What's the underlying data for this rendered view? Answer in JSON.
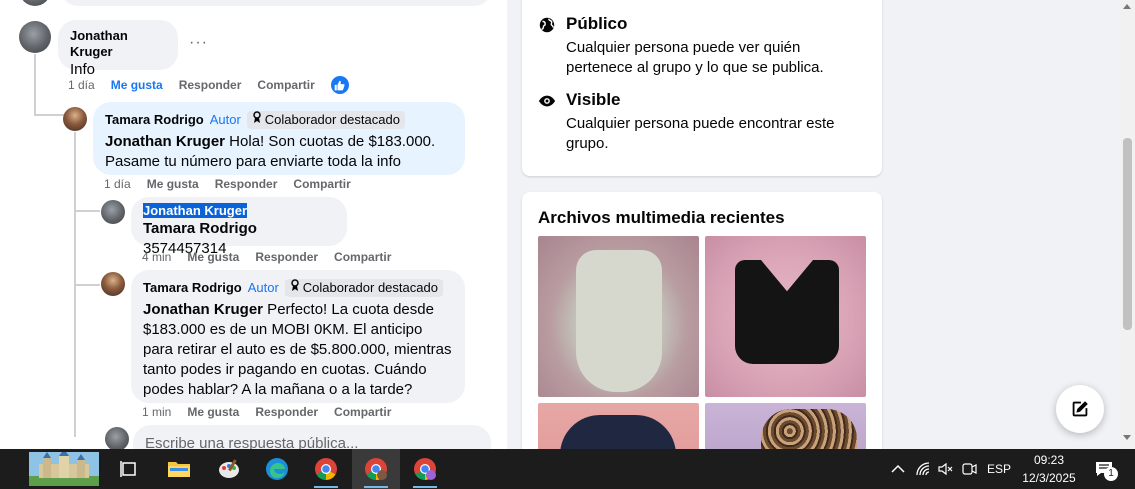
{
  "thread": {
    "c1": {
      "author": "Jonathan Kruger",
      "text": "Info",
      "actions": {
        "time": "1 día",
        "like": "Me gusta",
        "reply": "Responder",
        "share": "Compartir"
      },
      "more": "···"
    },
    "c2": {
      "author": "Tamara Rodrigo",
      "author_tag": "Autor",
      "badge": "Colaborador destacado",
      "mention": "Jonathan Kruger",
      "text": " Hola! Son cuotas de $183.000. Pasame tu número para enviarte toda la info",
      "actions": {
        "time": "1 día",
        "like": "Me gusta",
        "reply": "Responder",
        "share": "Compartir"
      }
    },
    "c3": {
      "author": "Jonathan Kruger",
      "mention": "Tamara Rodrigo",
      "text": " 3574457314",
      "actions": {
        "time": "4 min",
        "like": "Me gusta",
        "reply": "Responder",
        "share": "Compartir"
      }
    },
    "c4": {
      "author": "Tamara Rodrigo",
      "author_tag": "Autor",
      "badge": "Colaborador destacado",
      "mention": "Jonathan Kruger",
      "text": " Perfecto! La cuota desde $183.000 es de un MOBI 0KM. El anticipo para retirar el auto es de $5.800.000, mientras tanto podes ir pagando en cuotas. Cuándo podes hablar? A la mañana o a la tarde?",
      "actions": {
        "time": "1 min",
        "like": "Me gusta",
        "reply": "Responder",
        "share": "Compartir"
      }
    },
    "reply_placeholder": "Escribe una respuesta pública..."
  },
  "group_info": {
    "public": {
      "title": "Público",
      "desc": "Cualquier persona puede ver quién pertenece al grupo y lo que se publica."
    },
    "visible": {
      "title": "Visible",
      "desc": "Cualquier persona puede encontrar este grupo."
    }
  },
  "media": {
    "title": "Archivos multimedia recientes"
  },
  "taskbar": {
    "language": "ESP",
    "time": "09:23",
    "date": "12/3/2025",
    "notification_count": "1"
  },
  "colors": {
    "accent": "#1877f2",
    "bubble": "#f0f2f5",
    "author_bubble": "#e7f3ff",
    "taskbar": "#1c1c1c"
  }
}
